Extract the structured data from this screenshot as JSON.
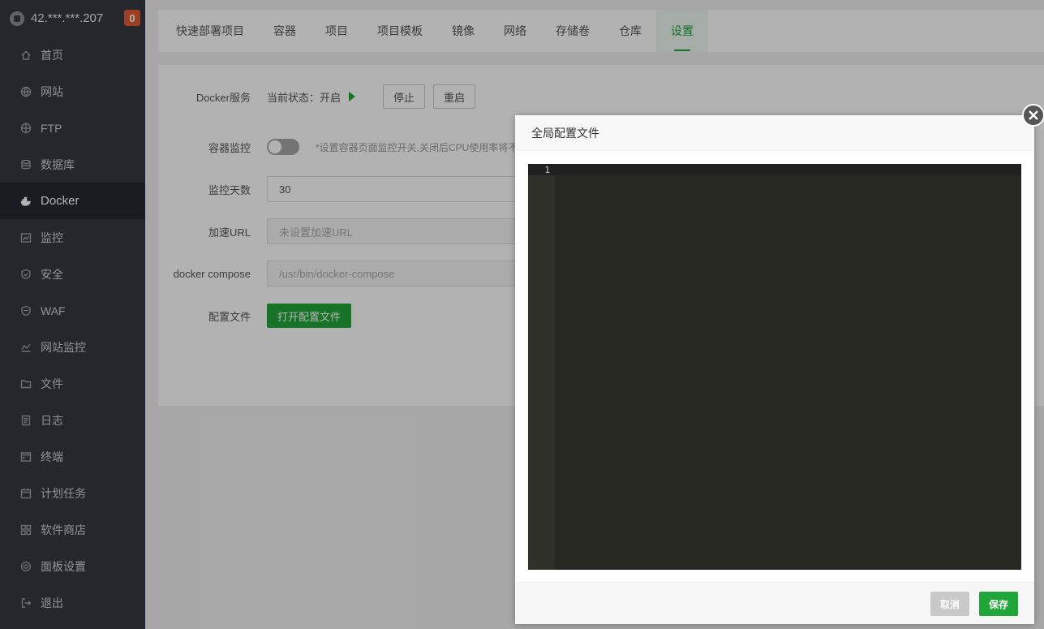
{
  "sidebar": {
    "server_ip": "42.***.***.207",
    "badge": "0",
    "items": [
      {
        "label": "首页",
        "icon": "home-icon"
      },
      {
        "label": "网站",
        "icon": "globe-icon"
      },
      {
        "label": "FTP",
        "icon": "ftp-globe-icon"
      },
      {
        "label": "数据库",
        "icon": "database-icon"
      },
      {
        "label": "Docker",
        "icon": "docker-icon",
        "active": true
      },
      {
        "label": "监控",
        "icon": "monitor-chart-icon"
      },
      {
        "label": "安全",
        "icon": "shield-icon"
      },
      {
        "label": "WAF",
        "icon": "waf-shield-icon"
      },
      {
        "label": "网站监控",
        "icon": "site-monitor-icon"
      },
      {
        "label": "文件",
        "icon": "folder-icon"
      },
      {
        "label": "日志",
        "icon": "log-icon"
      },
      {
        "label": "终端",
        "icon": "terminal-icon"
      },
      {
        "label": "计划任务",
        "icon": "calendar-icon"
      },
      {
        "label": "软件商店",
        "icon": "grid-apps-icon"
      },
      {
        "label": "面板设置",
        "icon": "gear-icon"
      },
      {
        "label": "退出",
        "icon": "logout-icon"
      }
    ]
  },
  "tabs": [
    {
      "label": "快速部署项目"
    },
    {
      "label": "容器"
    },
    {
      "label": "项目"
    },
    {
      "label": "项目模板"
    },
    {
      "label": "镜像"
    },
    {
      "label": "网络"
    },
    {
      "label": "存储卷"
    },
    {
      "label": "仓库"
    },
    {
      "label": "设置",
      "active": true
    }
  ],
  "settings": {
    "docker_service_label": "Docker服务",
    "status_text": "当前状态：开启",
    "stop_label": "停止",
    "restart_label": "重启",
    "monitor_label": "容器监控",
    "monitor_hint": "*设置容器页面监控开关,关闭后CPU使用率将不",
    "days_label": "监控天数",
    "days_value": "30",
    "accel_label": "加速URL",
    "accel_placeholder": "未设置加速URL",
    "compose_label": "docker compose",
    "compose_placeholder": "/usr/bin/docker-compose",
    "config_label": "配置文件",
    "open_config_label": "打开配置文件"
  },
  "modal": {
    "title": "全局配置文件",
    "line_number": "1",
    "cancel_label": "取消",
    "save_label": "保存"
  },
  "colors": {
    "accent": "#20a53a",
    "sidebar_bg": "#343a40",
    "editor_bg": "#272822",
    "badge": "#e05b34"
  }
}
